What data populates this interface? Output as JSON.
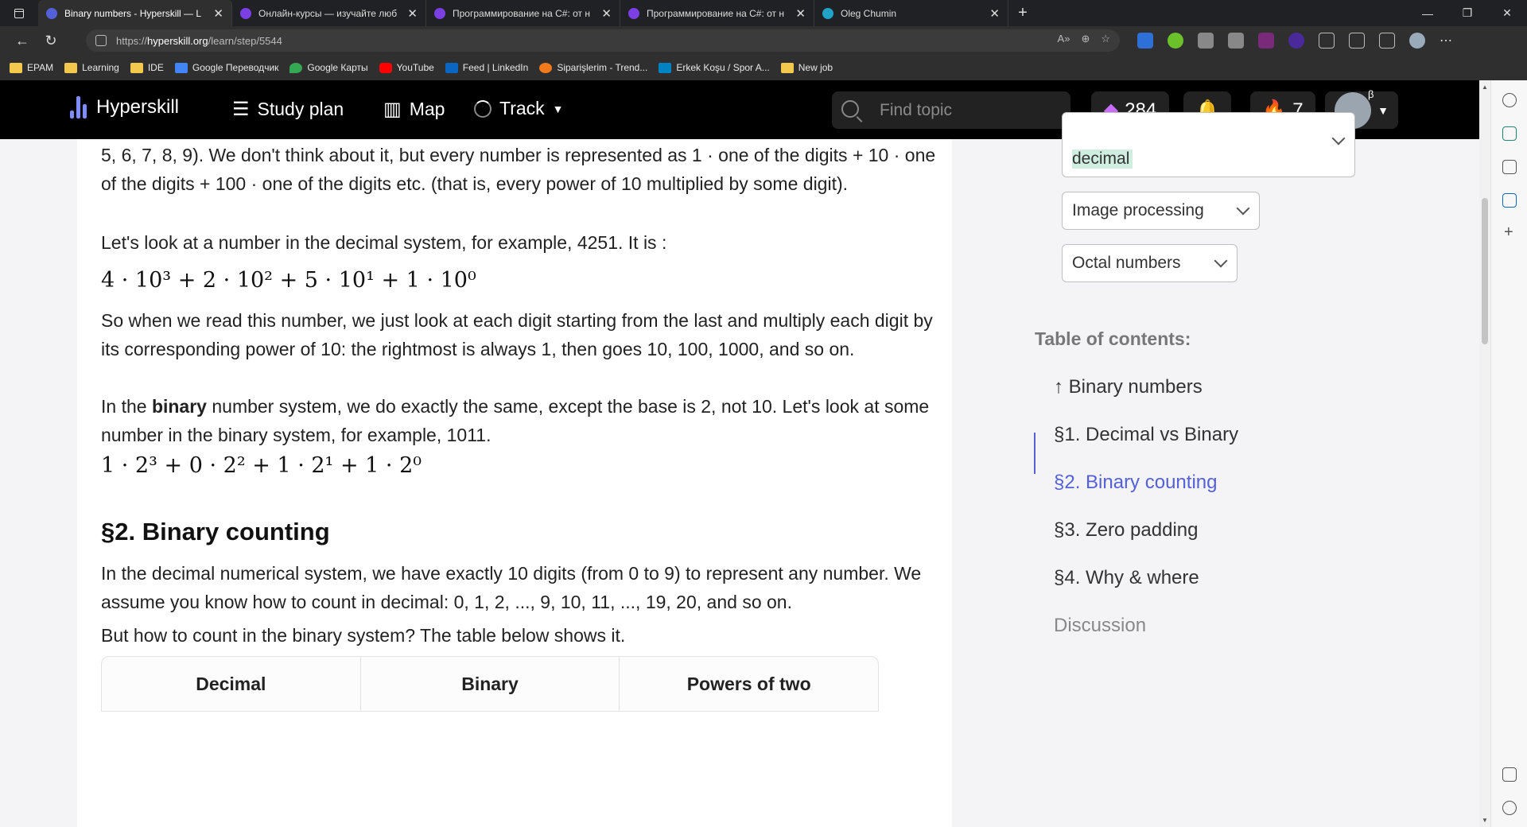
{
  "browser": {
    "tabs": [
      {
        "title": "Binary numbers - Hyperskill — L",
        "active": true,
        "favicon_color": "#5360d8"
      },
      {
        "title": "Онлайн-курсы — изучайте люб",
        "active": false,
        "favicon_color": "#7b3fe4"
      },
      {
        "title": "Программирование на C#: от н",
        "active": false,
        "favicon_color": "#7b3fe4"
      },
      {
        "title": "Программирование на C#: от н",
        "active": false,
        "favicon_color": "#7b3fe4"
      },
      {
        "title": "Oleg Chumin",
        "active": false,
        "favicon_color": "#1fa3c6"
      }
    ],
    "url_prefix": "https://",
    "url_host": "hyperskill.org",
    "url_path": "/learn/step/5544",
    "bookmarks": [
      "EPAM",
      "Learning",
      "IDE",
      "Google Переводчик",
      "Google Карты",
      "YouTube",
      "Feed | LinkedIn",
      "Siparişlerim - Trend...",
      "Erkek Koşu / Spor A...",
      "New job"
    ]
  },
  "header": {
    "brand": "Hyperskill",
    "nav": {
      "study_plan": "Study plan",
      "map": "Map",
      "track": "Track"
    },
    "search_placeholder": "Find topic",
    "gems": "284",
    "streak": "7",
    "avatar_badge": "β"
  },
  "article": {
    "p1": "5, 6, 7, 8, 9). We don't think about it, but every number is represented as 1 · one of the digits + 10 · one of the digits + 100 · one of the digits etc. (that is, every power of 10 multiplied by some digit).",
    "p2": "Let's look at a number in the decimal system, for example, 4251. It is :",
    "math1": "4 · 10³ + 2 · 10² + 5 · 10¹ + 1 · 10⁰",
    "p3": "So when we read this number, we just look at each digit starting from the last and multiply each digit by its corresponding power of 10: the rightmost is always 1, then goes 10, 100, 1000, and so on.",
    "p4_pre": "In the ",
    "p4_bold": "binary",
    "p4_post": " number system, we do exactly the same, except the base is 2, not 10. Let's look at some number in the binary system, for example, 1011.",
    "math2": "1 · 2³ + 0 · 2² + 1 · 2¹ + 1 · 2⁰",
    "section_title": "§2. Binary counting",
    "p5": "In the decimal numerical system, we have exactly 10 digits (from 0 to 9) to represent any number. We assume you know how to count in decimal: 0, 1, 2, ..., 9, 10, 11, ..., 19, 20, and so on.",
    "p6": "But how to count in the binary system? The table below shows it.",
    "table_headers": [
      "Decimal",
      "Binary",
      "Powers of two"
    ]
  },
  "side": {
    "topic1": "decimal",
    "topic2": "Image processing",
    "topic3": "Octal numbers",
    "toc_title": "Table of contents:",
    "toc": [
      "↑ Binary numbers",
      "§1. Decimal vs Binary",
      "§2. Binary counting",
      "§3. Zero padding",
      "§4. Why & where",
      "Discussion"
    ]
  }
}
